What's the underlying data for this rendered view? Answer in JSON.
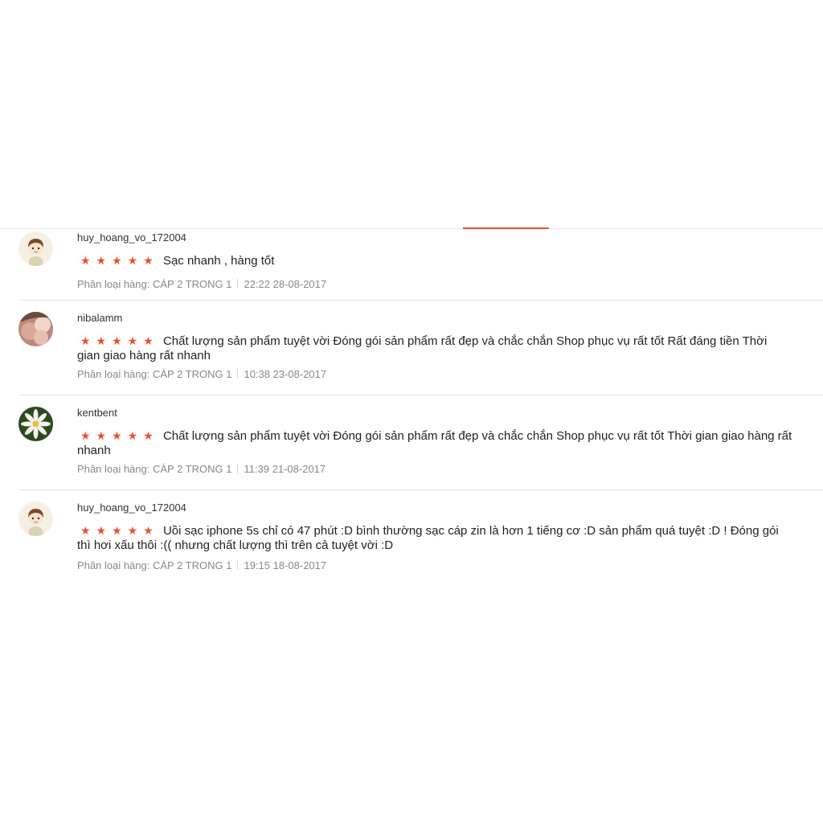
{
  "reviews": [
    {
      "username": "huy_hoang_vo_172004",
      "stars": "★★★★★",
      "rating": 5,
      "text": "Sạc nhanh , hàng tốt",
      "variation": "Phân loại hàng: CÁP 2 TRONG 1",
      "timestamp": "22:22 28-08-2017",
      "avatar_icon": "cartoon-boy-avatar-icon"
    },
    {
      "username": "nibalamm",
      "stars": "★★★★★",
      "rating": 5,
      "text": "Chất lượng sản phẩm tuyệt vời Đóng gói sản phẩm rất đẹp và chắc chắn Shop phục vụ rất tốt Rất đáng tiền Thời gian giao hàng rất nhanh",
      "variation": "Phân loại hàng: CÁP 2 TRONG 1",
      "timestamp": "10:38 23-08-2017",
      "avatar_icon": "photo-avatar-icon"
    },
    {
      "username": "kentbent",
      "stars": "★★★★★",
      "rating": 5,
      "text": "Chất lượng sản phẩm tuyệt vời Đóng gói sản phẩm rất đẹp và chắc chắn Shop phục vụ rất tốt  Thời gian giao hàng rất nhanh",
      "variation": "Phân loại hàng: CÁP 2 TRONG 1",
      "timestamp": "11:39 21-08-2017",
      "avatar_icon": "white-flower-avatar-icon"
    },
    {
      "username": "huy_hoang_vo_172004",
      "stars": "★★★★★",
      "rating": 5,
      "text": "Uồi sạc iphone 5s chỉ có 47 phút :D bình thường sạc cáp zin là hơn 1 tiếng cơ :D sản phẩm quá tuyệt :D ! Đóng gói thì hơi xấu thôi :(( nhưng chất lượng thì trên cả tuyệt vời :D",
      "variation": "Phân loại hàng: CÁP 2 TRONG 1",
      "timestamp": "19:15 18-08-2017",
      "avatar_icon": "cartoon-boy-avatar-icon"
    }
  ],
  "colors": {
    "accent": "#ee4d2d",
    "meta_text": "#888888",
    "divider": "#e4e4e4"
  }
}
